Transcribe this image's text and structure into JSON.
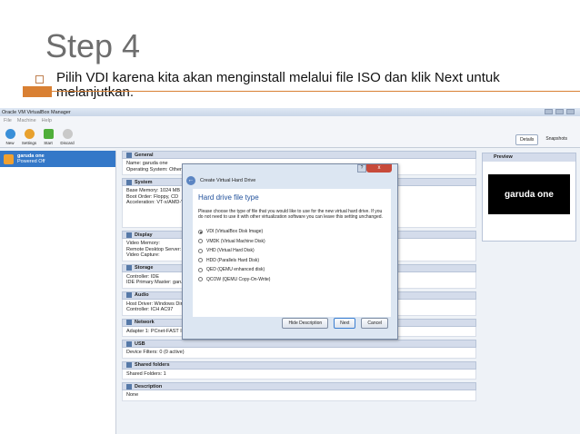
{
  "slide": {
    "title": "Step 4",
    "bullet": "Pilih VDI karena kita akan menginstall melalui file ISO dan klik Next untuk melanjutkan."
  },
  "vbox": {
    "window_title": "Oracle VM VirtualBox Manager",
    "menu": [
      "File",
      "Machine",
      "Help"
    ],
    "toolbar": [
      "New",
      "Settings",
      "Start",
      "Discard"
    ],
    "right_tools": [
      "Details",
      "Snapshots"
    ],
    "vm": {
      "name": "garuda one",
      "state": "Powered Off"
    },
    "sections": {
      "general": {
        "title": "General",
        "lines": [
          "Name:            garuda one",
          "Operating System:  Other Linux"
        ]
      },
      "system": {
        "title": "System",
        "lines": [
          "Base Memory:   1024 MB",
          "Boot Order:    Floppy, CD",
          "Acceleration:  VT-x/AMD-V"
        ]
      },
      "display": {
        "title": "Display",
        "lines": [
          "Video Memory:",
          "Remote Desktop Server:",
          "Video Capture:"
        ]
      },
      "storage": {
        "title": "Storage",
        "lines": [
          "Controller: IDE",
          "IDE Primary Master:   garu"
        ]
      },
      "audio": {
        "title": "Audio",
        "lines": [
          "Host Driver:   Windows Dire",
          "Controller:    ICH AC97"
        ]
      },
      "network": {
        "title": "Network",
        "lines": [
          "Adapter 1:   PCnet-FAST III (NAT)"
        ]
      },
      "usb": {
        "title": "USB",
        "lines": [
          "Device Filters:   0 (0 active)"
        ]
      },
      "shared": {
        "title": "Shared folders",
        "lines": [
          "Shared Folders:   1"
        ]
      },
      "description": {
        "title": "Description",
        "lines": [
          "None"
        ]
      }
    },
    "preview": {
      "title": "Preview",
      "screen_text": "garuda one"
    }
  },
  "dialog": {
    "title": "Create Virtual Hard Drive",
    "heading": "Hard drive file type",
    "description": "Please choose the type of file that you would like to use for the new virtual hard drive. If you do not need to use it with other virtualization software you can leave this setting unchanged.",
    "options": [
      {
        "label": "VDI (VirtualBox Disk Image)",
        "selected": true
      },
      {
        "label": "VMDK (Virtual Machine Disk)",
        "selected": false
      },
      {
        "label": "VHD (Virtual Hard Disk)",
        "selected": false
      },
      {
        "label": "HDD (Parallels Hard Disk)",
        "selected": false
      },
      {
        "label": "QED (QEMU enhanced disk)",
        "selected": false
      },
      {
        "label": "QCOW (QEMU Copy-On-Write)",
        "selected": false
      }
    ],
    "buttons": {
      "hide": "Hide Description",
      "next": "Next",
      "cancel": "Cancel"
    },
    "help": "?",
    "close": "x"
  }
}
